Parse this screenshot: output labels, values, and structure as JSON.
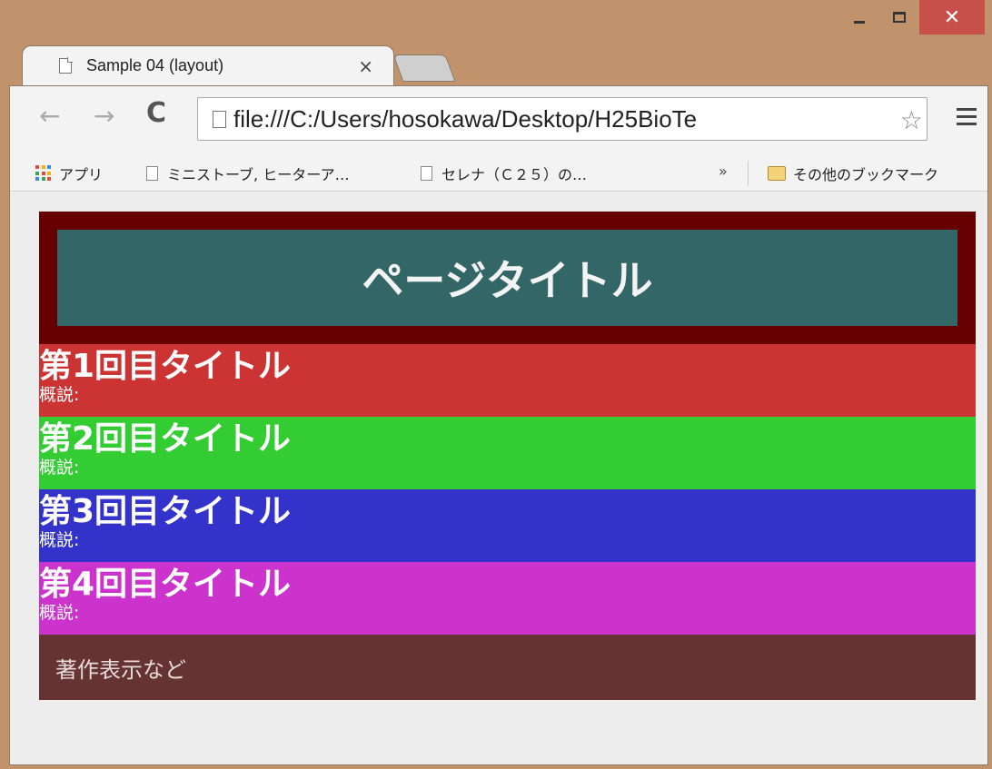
{
  "window": {
    "minimize_label": "",
    "close_glyph": "✕"
  },
  "tab": {
    "title": "Sample 04 (layout)",
    "close_glyph": "×",
    "icon": "page-icon"
  },
  "toolbar": {
    "back_glyph": "←",
    "forward_glyph": "→",
    "reload_glyph": "C",
    "url": "file:///C:/Users/hosokawa/Desktop/H25BioTe",
    "star_glyph": "☆"
  },
  "bookmarks": {
    "apps_label": "アプリ",
    "items": [
      "ミニストーブ, ヒーターア…",
      "セレナ（Ｃ２５）の…"
    ],
    "overflow_glyph": "»",
    "other_label": "その他のブックマーク"
  },
  "page": {
    "title": "ページタイトル",
    "sections": [
      {
        "title": "第1回目タイトル",
        "desc": "概説:",
        "color": "#cc3333"
      },
      {
        "title": "第2回目タイトル",
        "desc": "概説:",
        "color": "#33cc33"
      },
      {
        "title": "第3回目タイトル",
        "desc": "概説:",
        "color": "#3333cc"
      },
      {
        "title": "第4回目タイトル",
        "desc": "概説:",
        "color": "#cc33cc"
      }
    ],
    "footer": "著作表示など"
  },
  "colors": {
    "header_outer": "#660000",
    "header_inner": "#336666",
    "footer": "#663333",
    "window_frame": "#c0936c",
    "close_button": "#c7504a"
  }
}
